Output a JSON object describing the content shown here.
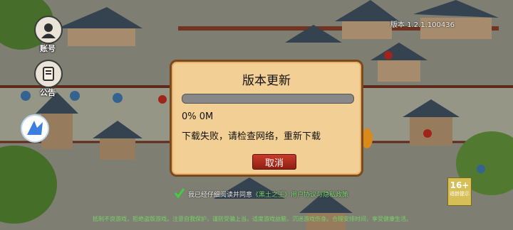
{
  "side_buttons": [
    {
      "label": "账号",
      "icon": "account-avatar-icon"
    },
    {
      "label": "公告",
      "icon": "announcement-scroll-icon"
    }
  ],
  "version_label": "版本 1.2.1.100436",
  "dialog": {
    "title": "版本更新",
    "progress_fraction": 0,
    "progress_text": "0%  0M",
    "message": "下载失败，请检查网络，重新下载",
    "cancel_label": "取消"
  },
  "consent": {
    "prefix": "我已经仔细阅读并同意",
    "link": "《黑土之王》用户协议与隐私政策"
  },
  "age_rating": {
    "big": "16+",
    "small": "适龄提示"
  },
  "footer_text": "抵制不良游戏，拒绝盗版游戏。注意自我保护，谨防受骗上当。适度游戏益脑，沉迷游戏伤身。合理安排时间，享受健康生活。",
  "colors": {
    "dialog_bg": "#f2cf95",
    "dialog_border": "#7b4a1c",
    "cancel_button": "#b83324",
    "progress_track": "#888888",
    "consent_link": "#7ee074"
  }
}
